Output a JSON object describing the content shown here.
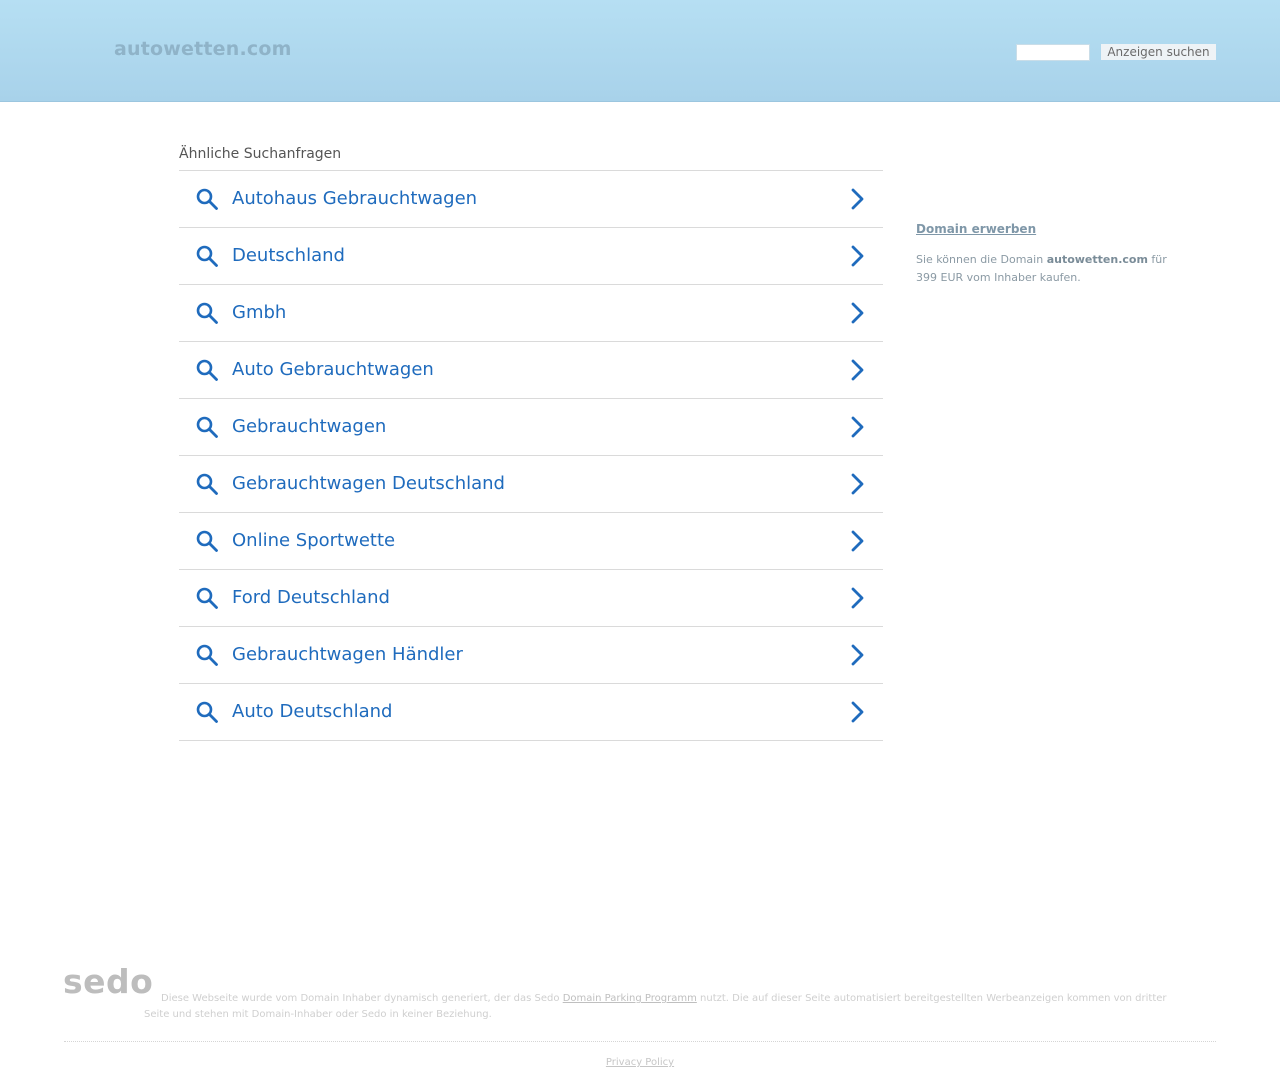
{
  "header": {
    "logo": "autowetten.com",
    "search_placeholder": "",
    "search_button": "Anzeigen suchen"
  },
  "related": {
    "title": "Ähnliche Suchanfragen",
    "items": [
      {
        "label": "Autohaus Gebrauchtwagen"
      },
      {
        "label": "Deutschland"
      },
      {
        "label": "Gmbh"
      },
      {
        "label": "Auto Gebrauchtwagen"
      },
      {
        "label": "Gebrauchtwagen"
      },
      {
        "label": "Gebrauchtwagen Deutschland"
      },
      {
        "label": "Online Sportwette"
      },
      {
        "label": "Ford Deutschland"
      },
      {
        "label": "Gebrauchtwagen Händler"
      },
      {
        "label": "Auto Deutschland"
      }
    ]
  },
  "side": {
    "title": "Domain erwerben",
    "text_before": "Sie können die Domain ",
    "domain": "autowetten.com",
    "text_after": " für 399 EUR vom Inhaber kaufen."
  },
  "footer": {
    "logo": "sedo",
    "text_before": "Diese Webseite wurde vom Domain Inhaber dynamisch generiert, der das Sedo ",
    "link": "Domain Parking Programm",
    "text_after": " nutzt. Die auf dieser Seite automatisiert bereitgestellten Werbeanzeigen kommen von dritter Seite und stehen mit Domain-Inhaber oder Sedo in keiner Beziehung.",
    "privacy": "Privacy Policy"
  },
  "colors": {
    "link": "#1f6bbd",
    "header_top": "#b6dff3",
    "header_bottom": "#a8d2ea"
  },
  "icons": {
    "result_left": "search-icon",
    "result_right": "chevron-right-icon"
  }
}
